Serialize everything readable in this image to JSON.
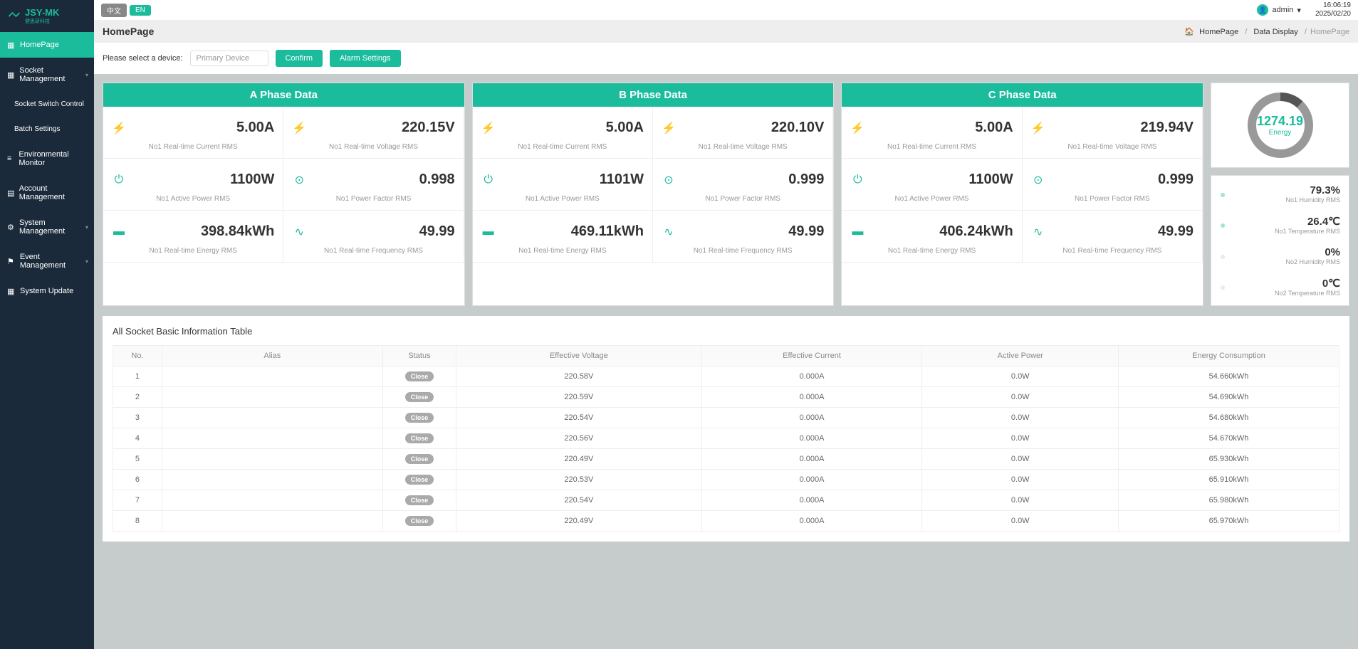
{
  "logo": {
    "brand": "JSY-MK",
    "sub": "健思研科技"
  },
  "topbar": {
    "lang_zh": "中文",
    "lang_en": "EN",
    "user": "admin",
    "time": "16:06:19",
    "date": "2025/02/20"
  },
  "crumb": {
    "title": "HomePage",
    "home": "HomePage",
    "mid": "Data Display",
    "last": "HomePage"
  },
  "filter": {
    "label": "Please select a device:",
    "device": "Primary Device",
    "confirm": "Confirm",
    "alarm": "Alarm Settings"
  },
  "nav": {
    "home": "HomePage",
    "socket_mgmt": "Socket Management",
    "socket_switch": "Socket Switch Control",
    "batch": "Batch Settings",
    "env": "Environmental Monitor",
    "account": "Account Management",
    "system": "System Management",
    "event": "Event Management",
    "update": "System Update"
  },
  "phases": [
    {
      "title": "A Phase Data",
      "metrics": [
        {
          "value": "5.00A",
          "label": "No1 Real-time Current RMS",
          "icon": "bolt"
        },
        {
          "value": "220.15V",
          "label": "No1 Real-time Voltage RMS",
          "icon": "bolt"
        },
        {
          "value": "1100W",
          "label": "No1 Active Power RMS",
          "icon": "power"
        },
        {
          "value": "0.998",
          "label": "No1 Power Factor RMS",
          "icon": "gauge"
        },
        {
          "value": "398.84kWh",
          "label": "No1 Real-time Energy RMS",
          "icon": "battery"
        },
        {
          "value": "49.99",
          "label": "No1 Real-time Frequency RMS",
          "icon": "wave"
        }
      ]
    },
    {
      "title": "B Phase Data",
      "metrics": [
        {
          "value": "5.00A",
          "label": "No1 Real-time Current RMS",
          "icon": "bolt"
        },
        {
          "value": "220.10V",
          "label": "No1 Real-time Voltage RMS",
          "icon": "bolt"
        },
        {
          "value": "1101W",
          "label": "No1 Active Power RMS",
          "icon": "power"
        },
        {
          "value": "0.999",
          "label": "No1 Power Factor RMS",
          "icon": "gauge"
        },
        {
          "value": "469.11kWh",
          "label": "No1 Real-time Energy RMS",
          "icon": "battery"
        },
        {
          "value": "49.99",
          "label": "No1 Real-time Frequency RMS",
          "icon": "wave"
        }
      ]
    },
    {
      "title": "C Phase Data",
      "metrics": [
        {
          "value": "5.00A",
          "label": "No1 Real-time Current RMS",
          "icon": "bolt"
        },
        {
          "value": "219.94V",
          "label": "No1 Real-time Voltage RMS",
          "icon": "bolt"
        },
        {
          "value": "1100W",
          "label": "No1 Active Power RMS",
          "icon": "power"
        },
        {
          "value": "0.999",
          "label": "No1 Power Factor RMS",
          "icon": "gauge"
        },
        {
          "value": "406.24kWh",
          "label": "No1 Real-time Energy RMS",
          "icon": "battery"
        },
        {
          "value": "49.99",
          "label": "No1 Real-time Frequency RMS",
          "icon": "wave"
        }
      ]
    }
  ],
  "energy": {
    "value": "1274.19",
    "label": "Energy"
  },
  "env": [
    {
      "value": "79.3%",
      "label": "No1 Humidity RMS",
      "muted": false
    },
    {
      "value": "26.4℃",
      "label": "No1 Temperature RMS",
      "muted": false
    },
    {
      "value": "0%",
      "label": "No2 Humidity RMS",
      "muted": true
    },
    {
      "value": "0℃",
      "label": "No2 Temperature RMS",
      "muted": true
    }
  ],
  "table": {
    "title": "All Socket Basic Information Table",
    "headers": [
      "No.",
      "Alias",
      "Status",
      "Effective Voltage",
      "Effective Current",
      "Active Power",
      "Energy Consumption"
    ],
    "close_label": "Close",
    "rows": [
      {
        "no": "1",
        "alias": "",
        "voltage": "220.58V",
        "current": "0.000A",
        "power": "0.0W",
        "energy": "54.660kWh"
      },
      {
        "no": "2",
        "alias": "",
        "voltage": "220.59V",
        "current": "0.000A",
        "power": "0.0W",
        "energy": "54.690kWh"
      },
      {
        "no": "3",
        "alias": "",
        "voltage": "220.54V",
        "current": "0.000A",
        "power": "0.0W",
        "energy": "54.680kWh"
      },
      {
        "no": "4",
        "alias": "",
        "voltage": "220.56V",
        "current": "0.000A",
        "power": "0.0W",
        "energy": "54.670kWh"
      },
      {
        "no": "5",
        "alias": "",
        "voltage": "220.49V",
        "current": "0.000A",
        "power": "0.0W",
        "energy": "65.930kWh"
      },
      {
        "no": "6",
        "alias": "",
        "voltage": "220.53V",
        "current": "0.000A",
        "power": "0.0W",
        "energy": "65.910kWh"
      },
      {
        "no": "7",
        "alias": "",
        "voltage": "220.54V",
        "current": "0.000A",
        "power": "0.0W",
        "energy": "65.980kWh"
      },
      {
        "no": "8",
        "alias": "",
        "voltage": "220.49V",
        "current": "0.000A",
        "power": "0.0W",
        "energy": "65.970kWh"
      }
    ]
  },
  "icons": {
    "bolt": "⚡",
    "power": "⏻",
    "gauge": "◉",
    "battery": "▬",
    "wave": "〰",
    "drop": "💧",
    "thermo": "🌡"
  }
}
